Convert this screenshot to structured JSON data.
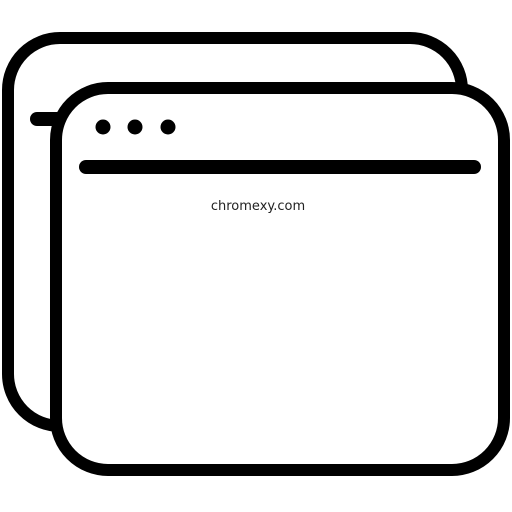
{
  "icon": {
    "name": "browser-windows-icon",
    "stroke_color": "#000000",
    "fill_color": "#ffffff"
  },
  "watermark": {
    "text": "chromexy.com"
  }
}
